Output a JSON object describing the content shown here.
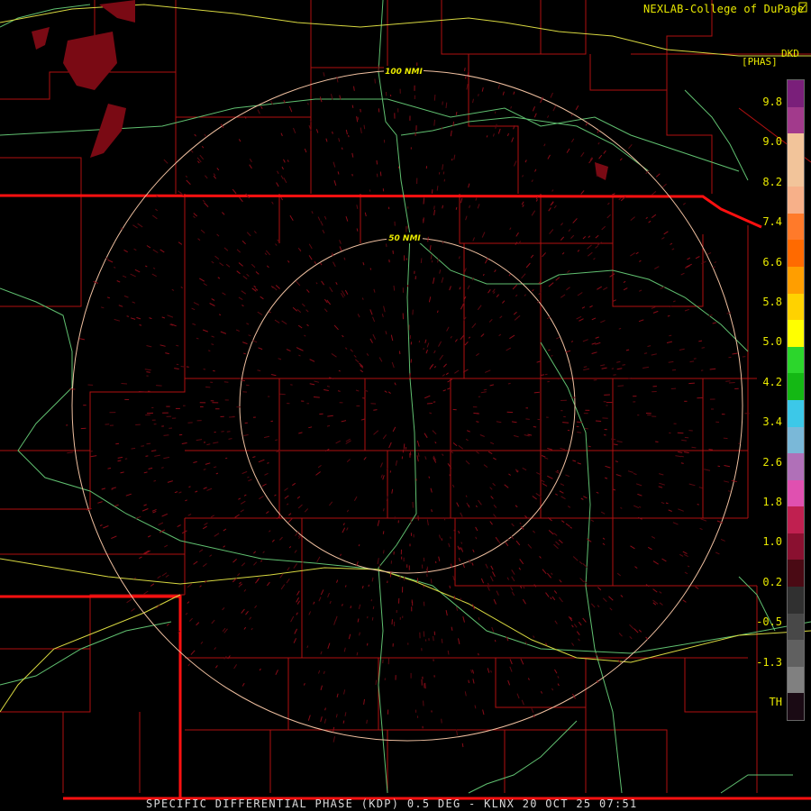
{
  "header": {
    "credit": "NEXLAB-College of DuPage",
    "logo_icon": "cod-logo-icon",
    "station_label": "DKD",
    "product_unit": "[PHAS]"
  },
  "range_rings": [
    {
      "label": "100 NMI"
    },
    {
      "label": "50 NMI"
    }
  ],
  "color_scale": {
    "labels": [
      "9.8",
      "9.0",
      "8.2",
      "7.4",
      "6.6",
      "5.8",
      "5.0",
      "4.2",
      "3.4",
      "2.6",
      "1.8",
      "1.0",
      "0.2",
      "-0.5",
      "-1.3",
      "TH"
    ],
    "colors": [
      "#7a1f7a",
      "#a23a8c",
      "#f2c49a",
      "#f2c49a",
      "#f7b089",
      "#ff7a2a",
      "#ff6a00",
      "#ff9e00",
      "#ffd200",
      "#ffff00",
      "#2cd62c",
      "#14b814",
      "#3cc8e8",
      "#7ab8d8",
      "#b070b8",
      "#e050b0",
      "#c02050",
      "#8a1030",
      "#4a0a14",
      "#303030",
      "#484848",
      "#606060",
      "#808080",
      "#1a0a14"
    ]
  },
  "footer": {
    "caption": "SPECIFIC DIFFERENTIAL PHASE (KDP) 0.5 DEG - KLNX 20 OCT 25 07:51"
  }
}
